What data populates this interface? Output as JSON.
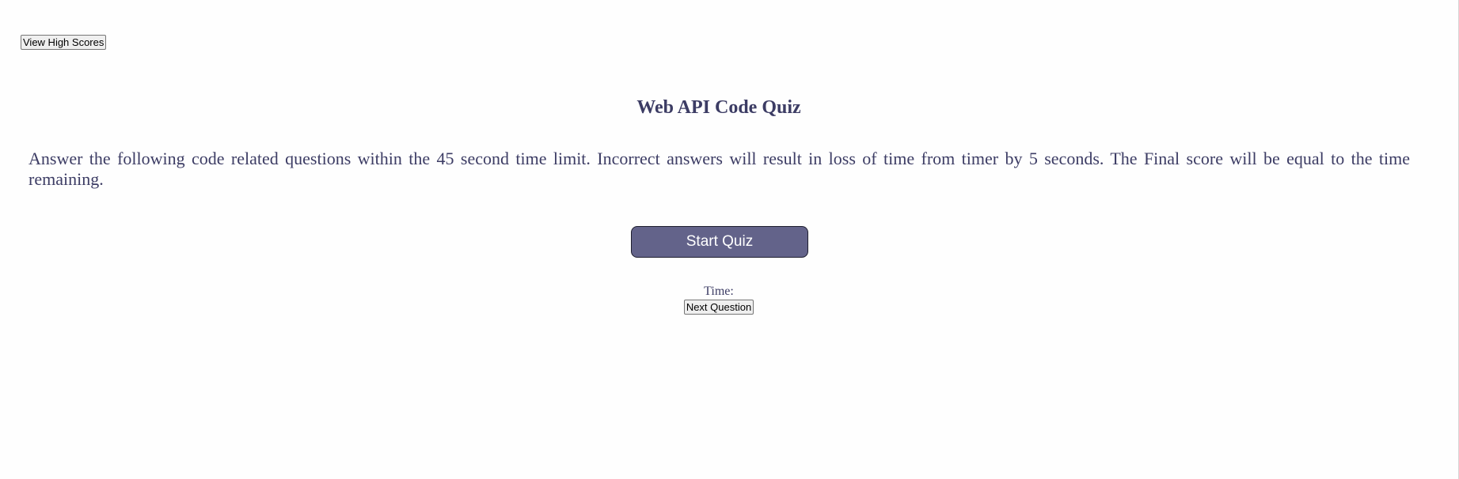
{
  "header": {
    "high_scores_label": "View High Scores"
  },
  "main": {
    "title": "Web API Code Quiz",
    "instructions": "Answer the following code related questions within the 45 second time limit. Incorrect answers will result in loss of time from timer by 5 seconds. The Final score will be equal to the time remaining.",
    "start_label": "Start Quiz"
  },
  "timer": {
    "label": "Time:",
    "value": ""
  },
  "controls": {
    "next_label": "Next Question"
  },
  "colors": {
    "text": "#3c3c64",
    "accent": "#63638a",
    "accent_text": "#ffffff"
  }
}
